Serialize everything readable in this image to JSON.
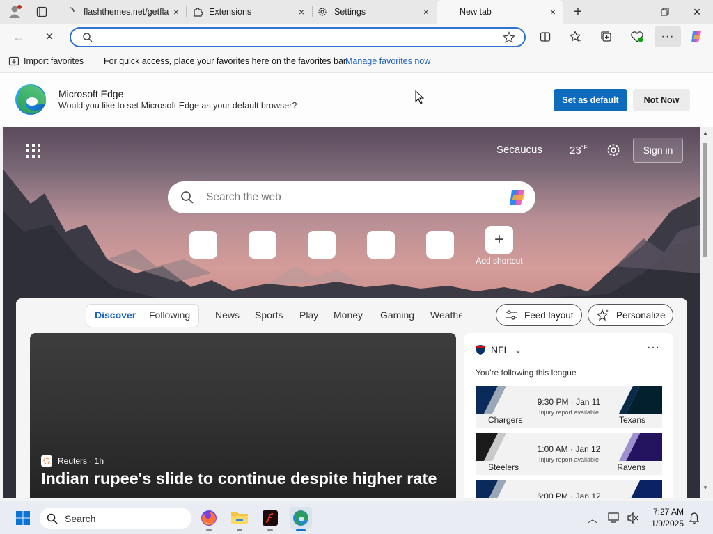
{
  "tabs": [
    {
      "label": "flashthemes.net/getfla",
      "icon": "loading-spinner-icon"
    },
    {
      "label": "Extensions",
      "icon": "puzzle-icon"
    },
    {
      "label": "Settings",
      "icon": "gear-icon"
    },
    {
      "label": "New tab",
      "icon": ""
    }
  ],
  "address": {
    "value": ""
  },
  "favorites_bar": {
    "import_label": "Import favorites",
    "hint": "For quick access, place your favorites here on the favorites bar.",
    "manage_link": "Manage favorites now"
  },
  "banner": {
    "title": "Microsoft Edge",
    "subtitle": "Would you like to set Microsoft Edge as your default browser?",
    "set_default": "Set as default",
    "not_now": "Not Now"
  },
  "ntp": {
    "location": "Secaucus",
    "temperature": "23",
    "temp_unit": "°F",
    "sign_in": "Sign in",
    "search_placeholder": "Search the web",
    "add_shortcut": "Add shortcut"
  },
  "feed": {
    "tabs": [
      "Discover",
      "Following",
      "News",
      "Sports",
      "Play",
      "Money",
      "Gaming",
      "Weathe"
    ],
    "active_tab": "Discover",
    "feed_layout": "Feed layout",
    "personalize": "Personalize",
    "hero": {
      "source": "Reuters · 1h",
      "title": "Indian rupee's slide to continue despite higher rate"
    },
    "nfl": {
      "league": "NFL",
      "following_text": "You're following this league",
      "games": [
        {
          "time": "9:30 PM · Jan 11",
          "note": "Injury report available",
          "away": "Chargers",
          "home": "Texans",
          "left_color": "#0a2a5c",
          "right_color": "#03202f"
        },
        {
          "time": "1:00 AM · Jan 12",
          "note": "Injury report available",
          "away": "Steelers",
          "home": "Ravens",
          "left_color": "#1b1b1b",
          "right_color": "#24135f"
        },
        {
          "time": "6:00 PM · Jan 12",
          "note": "",
          "away": "",
          "home": "",
          "left_color": "#0a2a5c",
          "right_color": "#0b2265"
        }
      ]
    }
  },
  "taskbar": {
    "search_placeholder": "Search",
    "time": "7:27 AM",
    "date": "1/9/2025"
  },
  "colors": {
    "accent": "#0f6cbd",
    "address_border": "#2f74d0",
    "active_tab_text": "#1763c6"
  }
}
